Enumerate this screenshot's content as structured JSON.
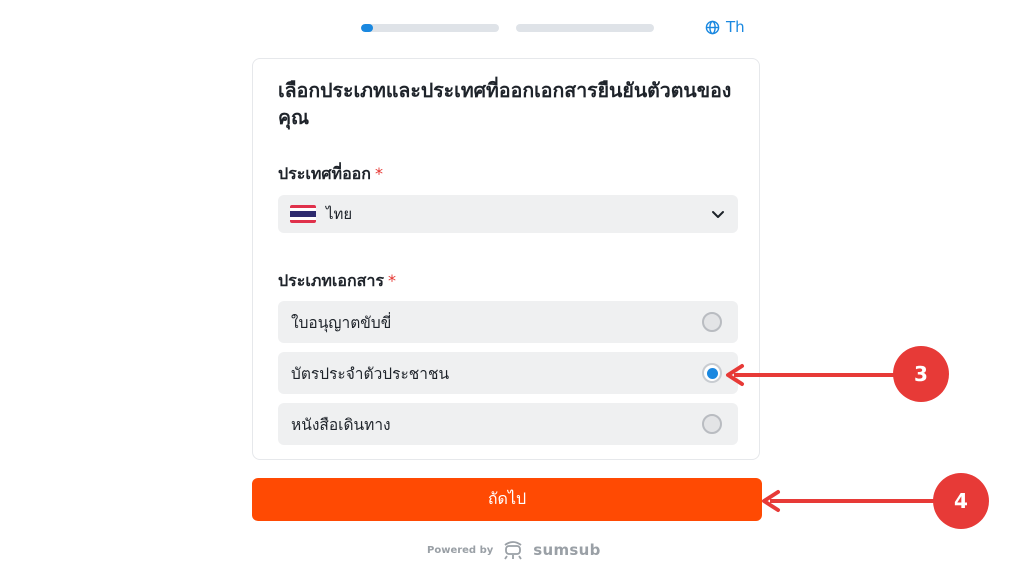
{
  "progress": {
    "steps": [
      {
        "fill": 0.09
      },
      {
        "fill": 0
      }
    ]
  },
  "language": {
    "label": "Th",
    "icon": "globe-icon"
  },
  "card": {
    "title": "เลือกประเภทและประเทศที่ออกเอกสารยืนยันตัวตนของคุณ",
    "country": {
      "label": "ประเทศที่ออก",
      "required_mark": "*",
      "selected": "ไทย",
      "flag_icon": "thailand-flag-icon"
    },
    "document_type": {
      "label": "ประเภทเอกสาร",
      "required_mark": "*",
      "options": [
        {
          "label": "ใบอนุญาตขับขี่",
          "selected": false
        },
        {
          "label": "บัตรประจำตัวประชาชน",
          "selected": true
        },
        {
          "label": "หนังสือเดินทาง",
          "selected": false
        }
      ]
    }
  },
  "next_button": {
    "label": "ถัดไป"
  },
  "footer": {
    "powered_by": "Powered by",
    "brand": "sumsub"
  },
  "annotations": [
    {
      "label": "3"
    },
    {
      "label": "4"
    }
  ],
  "colors": {
    "accent": "#1a88e0",
    "button": "#ff4a03",
    "callout": "#e73a37",
    "required": "#e5342f",
    "field_bg": "#eff0f1"
  }
}
